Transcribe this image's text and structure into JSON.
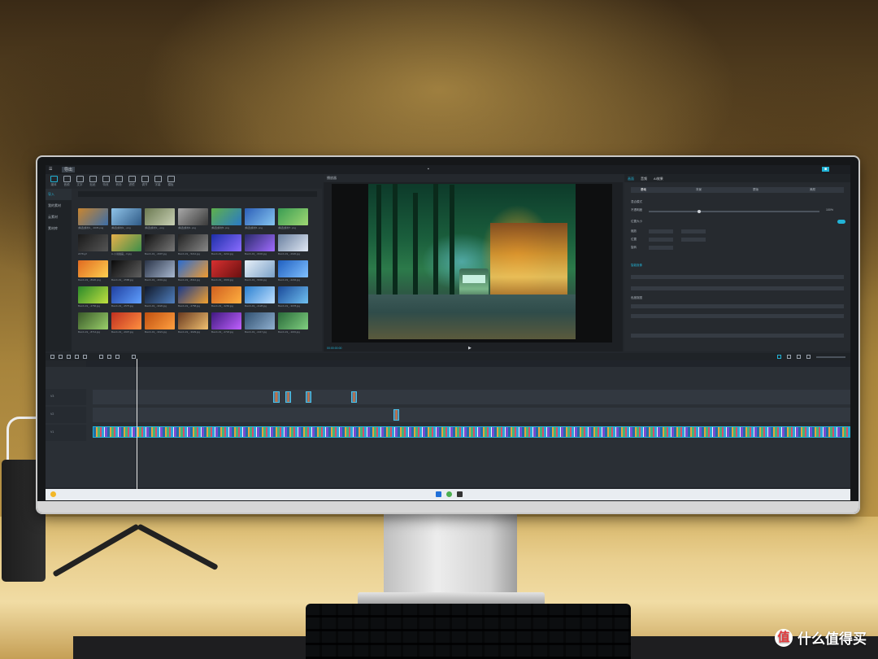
{
  "watermark": {
    "text": "什么值得买",
    "logo_char": "值"
  },
  "app": {
    "menu_items": [
      "导出"
    ],
    "toolbar": [
      "媒体",
      "音频",
      "文字",
      "贴纸",
      "特效",
      "转场",
      "滤镜",
      "调节",
      "字幕",
      "模板"
    ],
    "sidebar": [
      "导入",
      "我的素材",
      "云素材",
      "素材库"
    ],
    "preview_title": "播放器",
    "props_tabs": [
      "画面",
      "音频",
      "AI效果"
    ],
    "props_subtabs": [
      "基础",
      "背景",
      "蒙版",
      "美颜"
    ],
    "props_rows": [
      "混合模式",
      "不透明度",
      "位置大小",
      "缩放",
      "位置",
      "旋转",
      "智能抠像",
      "色度抠图"
    ],
    "opacity_value": "100%",
    "preview_time": "00:00:00:00",
    "thumb_captions": [
      "[精选]素材1_..3035.png",
      "[精选]素材2_..png",
      "[精选]素材3_..png",
      "[精选]素材4..png",
      "[精选]素材5..png",
      "[精选]素材6..png",
      "[精选]素材7..png",
      "2278.gif",
      "A-小说插画_..0.jpg",
      "Bomb-19_..2997.jpg",
      "Bomb-19_..5212.jpg",
      "Bomb-19_..3212.jpg",
      "Bomb-19_..6032.jpg",
      "Bomb-19_..2020.jpg",
      "Bomb-19_..8020.png",
      "Bomb-19_..2588.jpg",
      "Bomb-19_..4001.jpg",
      "Bomb-19_..8312.jpg",
      "Bomb-19_..3919.jpg",
      "Bomb-19_..5002.jpg",
      "Bomb-19_..2204.jpg",
      "Bomb-19_..2766.jpg",
      "Bomb-19_..2575.jpg",
      "Bomb-19_..3020.jpg",
      "Bomb-19_..2758.jpg",
      "Bomb-19_..3260.jpg",
      "Bomb-19_..4128.jpg",
      "Bomb-19_..3078.jpg",
      "Bomb-19_..8714.jpg",
      "Bomb-19_..2907.jpg",
      "Bomb-19_..3021.jpg",
      "Bomb-19_..3029.jpg",
      "Bomb-19_..2718.jpg",
      "Bomb-19_..2417.jpg",
      "Bomb-19_..1163.jpg"
    ],
    "track_labels": [
      "V3",
      "V2",
      "V1"
    ],
    "accent": "#22b3d6"
  }
}
